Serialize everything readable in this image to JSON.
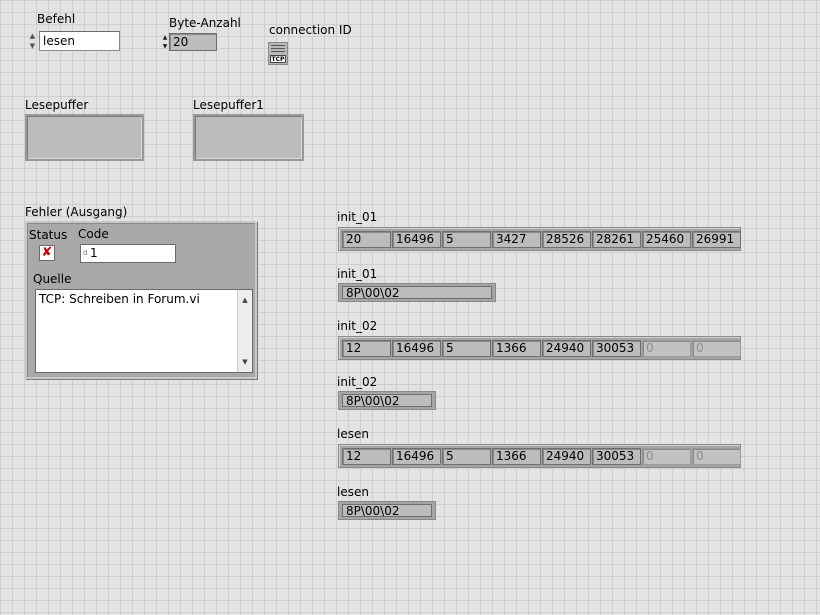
{
  "befehl": {
    "label": "Befehl",
    "value": "lesen"
  },
  "byte_anzahl": {
    "label": "Byte-Anzahl",
    "value": "20"
  },
  "connection": {
    "label": "connection ID",
    "icon": "tcp-refnum-icon",
    "badge": "TCP"
  },
  "lesepuffer": {
    "label": "Lesepuffer",
    "value": ""
  },
  "lesepuffer1": {
    "label": "Lesepuffer1",
    "value": ""
  },
  "error": {
    "label": "Fehler (Ausgang)",
    "status_label": "Status",
    "status_glyph": "✘",
    "code_label": "Code",
    "code_prefix": "d",
    "code_value": "1",
    "source_label": "Quelle",
    "source_value": "TCP: Schreiben in Forum.vi"
  },
  "arrays": [
    {
      "label": "init_01",
      "cells": [
        "20",
        "16496",
        "5",
        "3427",
        "28526",
        "28261",
        "25460",
        "26991"
      ],
      "dim_from": 8
    },
    {
      "label": "init_02",
      "cells": [
        "12",
        "16496",
        "5",
        "1366",
        "24940",
        "30053",
        "0",
        "0"
      ],
      "dim_from": 6
    },
    {
      "label": "lesen",
      "cells": [
        "12",
        "16496",
        "5",
        "1366",
        "24940",
        "30053",
        "0",
        "0"
      ],
      "dim_from": 6
    }
  ],
  "strings": [
    {
      "label": "init_01",
      "value": "8P\\00\\02"
    },
    {
      "label": "init_02",
      "value": "8P\\00\\02"
    },
    {
      "label": "lesen",
      "value": "8P\\00\\02"
    }
  ]
}
